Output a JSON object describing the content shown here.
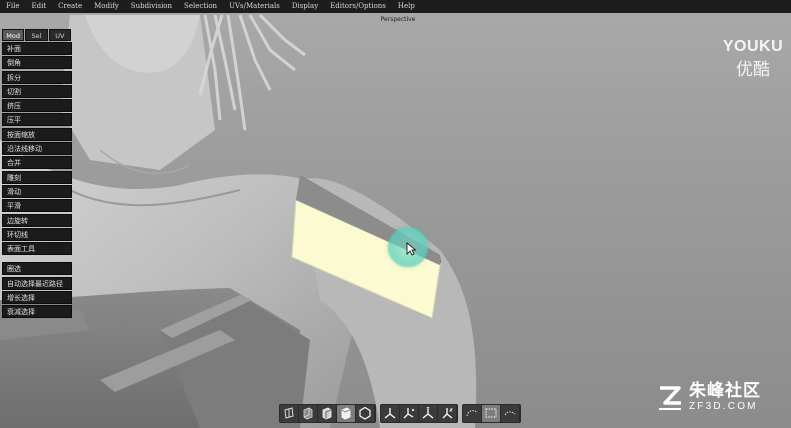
{
  "menubar": {
    "items": [
      "File",
      "Edit",
      "Create",
      "Modify",
      "Subdivision",
      "Selection",
      "UVs/Materials",
      "Display",
      "Editors/Options",
      "Help"
    ]
  },
  "viewport": {
    "label": "Perspective",
    "highlight_color": "#fbfad0"
  },
  "tool_panel": {
    "tabs": [
      {
        "label": "Mod",
        "active": true
      },
      {
        "label": "Sel",
        "active": false
      },
      {
        "label": "UV",
        "active": false
      }
    ],
    "tools": [
      "补面",
      "倒角",
      "拆分",
      "切割",
      "挤压",
      "压平",
      "按面缩放",
      "沿法线移动",
      "合并",
      "雕刻",
      "滑动",
      "平滑",
      "边旋转",
      "环切线",
      "表面工具"
    ],
    "selection_tools": [
      "圈选",
      "自动选择最近路径",
      "增长选择",
      "衰减选择"
    ]
  },
  "bottom_toolbar": {
    "view_buttons": [
      {
        "icon": "view-mode-1-icon"
      },
      {
        "icon": "view-mode-2-icon"
      },
      {
        "icon": "view-mode-3-icon"
      },
      {
        "icon": "view-mode-4-icon",
        "selected": true
      },
      {
        "icon": "view-mode-5-icon"
      }
    ],
    "axis_buttons": [
      {
        "icon": "axis-xyz-icon"
      },
      {
        "icon": "axis-x-icon"
      },
      {
        "icon": "axis-y-icon"
      },
      {
        "icon": "axis-z-icon"
      }
    ],
    "select_buttons": [
      {
        "icon": "lasso-select-icon"
      },
      {
        "icon": "rect-select-icon",
        "selected": true
      },
      {
        "icon": "paint-select-icon"
      }
    ]
  },
  "watermarks": {
    "youku_en": "YOUKU",
    "youku_cn": "优酷",
    "zf3d_cn": "朱峰社区",
    "zf3d_url": "ZF3D.COM"
  }
}
